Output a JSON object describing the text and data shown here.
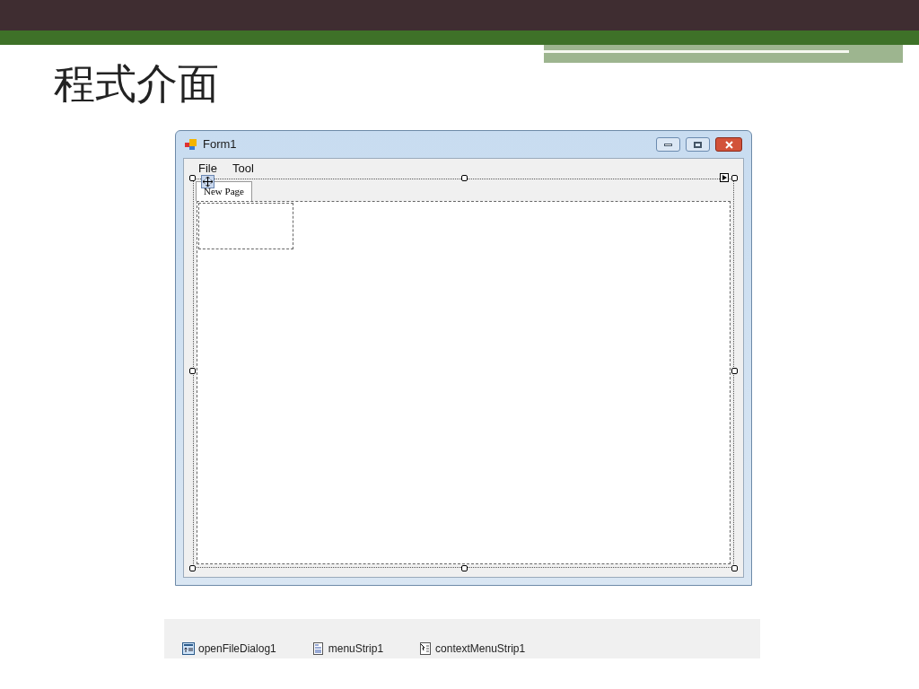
{
  "slide": {
    "title": "程式介面"
  },
  "window": {
    "title": "Form1"
  },
  "menu": [
    {
      "label": "File"
    },
    {
      "label": "Tool"
    }
  ],
  "tabs": [
    {
      "label": "New Page",
      "selected": true
    }
  ],
  "component_tray": [
    {
      "kind": "dialog",
      "label": "openFileDialog1"
    },
    {
      "kind": "menu",
      "label": "menuStrip1"
    },
    {
      "kind": "context",
      "label": "contextMenuStrip1"
    }
  ]
}
